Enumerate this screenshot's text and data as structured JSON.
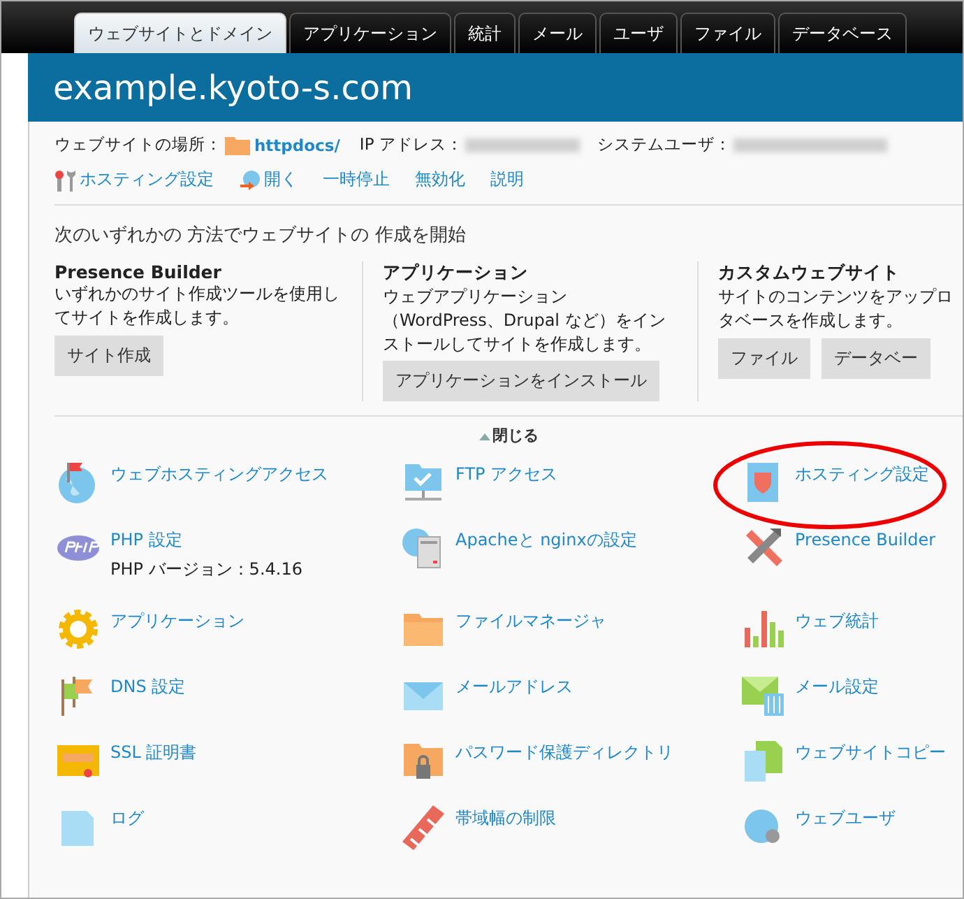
{
  "tabs": [
    {
      "label": "ウェブサイトとドメイン",
      "selected": true
    },
    {
      "label": "アプリケーション",
      "selected": false
    },
    {
      "label": "統計",
      "selected": false
    },
    {
      "label": "メール",
      "selected": false
    },
    {
      "label": "ユーザ",
      "selected": false
    },
    {
      "label": "ファイル",
      "selected": false
    },
    {
      "label": "データベース",
      "selected": false
    }
  ],
  "domain": {
    "title": "example.kyoto-s.com"
  },
  "info": {
    "location_label": "ウェブサイトの場所：",
    "location_link": "httpdocs/",
    "ip_label": "IP アドレス：",
    "user_label": "システムユーザ："
  },
  "actions": [
    {
      "label": "ホスティング設定"
    },
    {
      "label": "開く"
    },
    {
      "label": "一時停止"
    },
    {
      "label": "無効化"
    },
    {
      "label": "説明"
    }
  ],
  "start": {
    "heading": "次のいずれかの 方法でウェブサイトの 作成を開始",
    "columns": [
      {
        "title": "Presence Builder",
        "lines": [
          "いずれかのサイト作成ツールを使用してサイトを作成します。"
        ],
        "buttons": [
          "サイト作成"
        ]
      },
      {
        "title": "アプリケーション",
        "lines": [
          "ウェブアプリケーション（WordPress、Drupal など）をインストールしてサイトを作成します。"
        ],
        "buttons": [
          "アプリケーションをインストール"
        ]
      },
      {
        "title": "カスタムウェブサイト",
        "lines": [
          "サイトのコンテンツをアップロ",
          "タベースを作成します。"
        ],
        "buttons": [
          "ファイル",
          "データベー"
        ]
      }
    ]
  },
  "collapse": "閉じる",
  "tools": [
    {
      "label": "ウェブホスティングアクセス",
      "highlighted": false
    },
    {
      "label": "FTP アクセス",
      "highlighted": false
    },
    {
      "label": "ホスティング設定",
      "highlighted": true
    },
    {
      "label": "PHP 設定",
      "note": "PHP バージョン：5.4.16",
      "highlighted": false
    },
    {
      "label": "Apacheと nginxの設定",
      "highlighted": false
    },
    {
      "label": "Presence Builder",
      "highlighted": false
    },
    {
      "label": "アプリケーション",
      "highlighted": false
    },
    {
      "label": "ファイルマネージャ",
      "highlighted": false
    },
    {
      "label": "ウェブ統計",
      "highlighted": false
    },
    {
      "label": "DNS 設定",
      "highlighted": false
    },
    {
      "label": "メールアドレス",
      "highlighted": false
    },
    {
      "label": "メール設定",
      "highlighted": false
    },
    {
      "label": "SSL 証明書",
      "highlighted": false
    },
    {
      "label": "パスワード保護ディレクトリ",
      "highlighted": false
    },
    {
      "label": "ウェブサイトコピー",
      "highlighted": false
    },
    {
      "label": "ログ",
      "highlighted": false
    },
    {
      "label": "帯域幅の制限",
      "highlighted": false
    },
    {
      "label": "ウェブユーザ",
      "highlighted": false
    }
  ]
}
